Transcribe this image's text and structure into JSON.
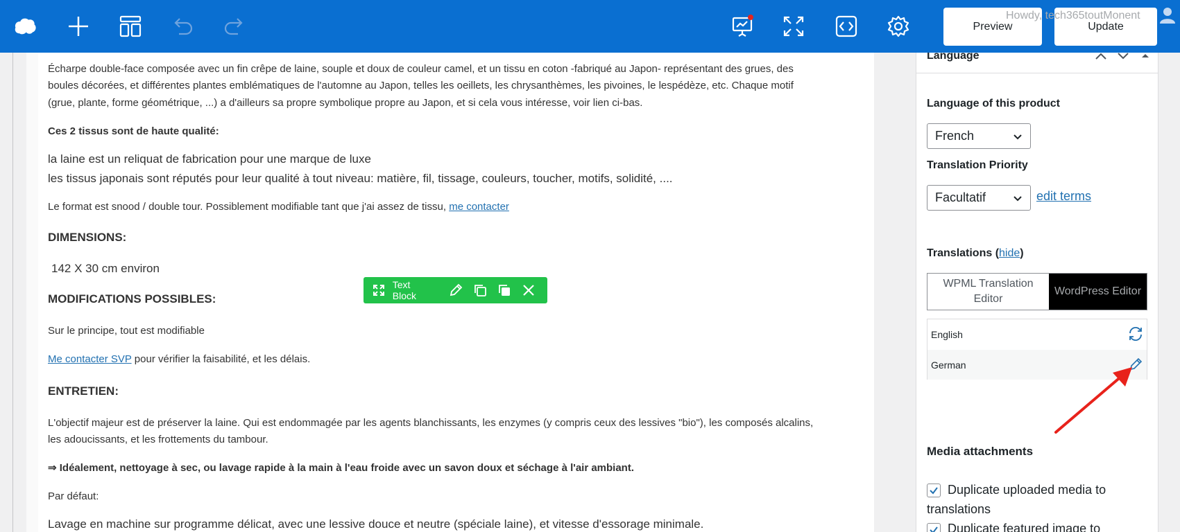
{
  "topbar": {
    "preview_label": "Preview",
    "update_label": "Update",
    "howdy_text": "Howdy, tech365toutMonent",
    "bg_color": "#0a6fd1"
  },
  "icons": {
    "logo": "cloud-logo-icon",
    "add": "plus-icon",
    "templates": "layout-icon",
    "undo": "undo-icon",
    "redo": "redo-icon",
    "presentation": "presentation-chart-icon",
    "fullscreen": "fullscreen-icon",
    "code": "code-icon",
    "settings": "gear-icon"
  },
  "content": {
    "p1_line1": "Écharpe double-face composée avec un fin crêpe de laine, souple et doux de couleur camel, et un tissu en coton -fabriqué au Japon- représentant des grues, des",
    "p1_line2": "boules décorées, et différentes plantes emblématiques de l'automne au Japon, telles les oeillets, les chrysanthèmes, les pivoines, le lespédèze, etc. Chaque motif",
    "p1_line3": "(grue, plante, forme géométrique, ...) a d'ailleurs sa propre symbolique propre au Japon, et si cela vous intéresse, voir lien ci-bas.",
    "quality_heading": "Ces 2 tissus sont de haute qualité:",
    "quality_line1": "la laine est un reliquat de fabrication pour une marque de luxe",
    "quality_line2": "les tissus japonais sont réputés pour leur qualité à tout niveau: matière, fil, tissage, couleurs, toucher, motifs, solidité, ....",
    "format_text": "Le format est snood / double tour. Possiblement modifiable tant que j'ai assez de tissu, ",
    "format_link": "me contacter",
    "dimensions_heading": "DIMENSIONS:",
    "dimensions_value": "142 X 30 cm environ",
    "modifications_heading": "MODIFICATIONS POSSIBLES:",
    "modifications_text": "Sur le principe, tout est modifiable",
    "contact_link": "Me contacter SVP",
    "contact_text": " pour vérifier la faisabilité, et les délais.",
    "entretien_heading": "ENTRETIEN:",
    "entretien_line1": "L'objectif majeur est de préserver la laine. Qui est endommagée par les agents blanchissants, les enzymes (y compris ceux des lessives \"bio\"), les composés alcalins,",
    "entretien_line2": "les adoucissants, et les frottements du tambour.",
    "ideal_text": "⇒ Idéalement, nettoyage à sec, ou lavage rapide à la main à l'eau froide avec un savon doux et séchage à l'air ambiant.",
    "default_label": "Par défaut:",
    "wash_text": "Lavage en machine sur programme délicat, avec une lessive douce et neutre (spéciale laine), et vitesse d'essorage minimale."
  },
  "element_toolbar": {
    "label": "Text Block",
    "color": "#22c24a"
  },
  "sidebar": {
    "panel_title": "Language",
    "language_label": "Language of this product",
    "language_value": "French",
    "priority_label": "Translation Priority",
    "priority_value": "Facultatif",
    "edit_terms": "edit terms",
    "translations_label": "Translations (",
    "translations_hide": "hide",
    "translations_close": ")",
    "wpml_editor": "WPML Translation Editor",
    "wp_editor": "WordPress Editor",
    "languages": [
      {
        "name": "English",
        "action_icon": "refresh-icon"
      },
      {
        "name": "German",
        "action_icon": "pencil-icon"
      }
    ],
    "media_heading": "Media attachments",
    "media_opt1_line1": "Duplicate uploaded media to",
    "media_opt1_line2": "translations",
    "media_opt2": "Duplicate featured image to"
  }
}
